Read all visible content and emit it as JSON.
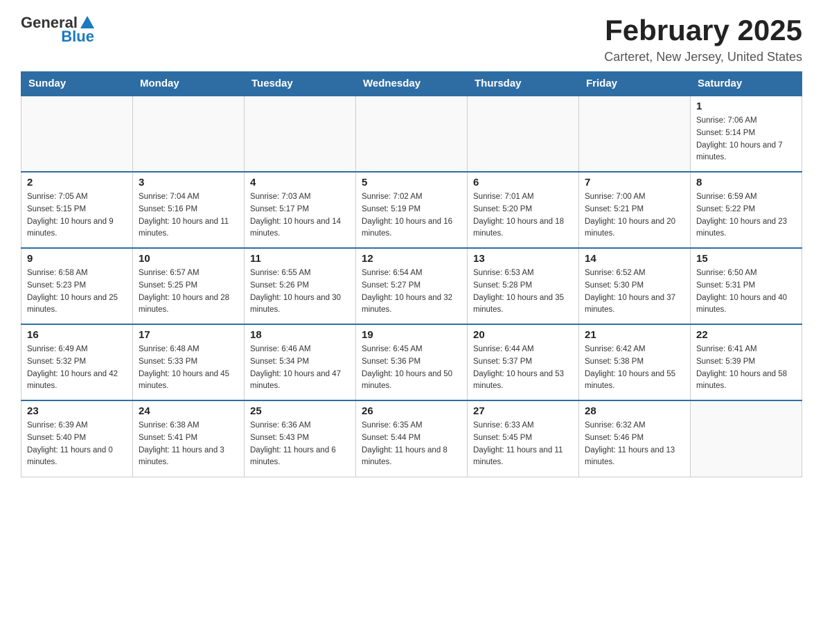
{
  "header": {
    "logo_general": "General",
    "logo_blue": "Blue",
    "title": "February 2025",
    "subtitle": "Carteret, New Jersey, United States"
  },
  "days_of_week": [
    "Sunday",
    "Monday",
    "Tuesday",
    "Wednesday",
    "Thursday",
    "Friday",
    "Saturday"
  ],
  "weeks": [
    [
      {
        "day": "",
        "info": ""
      },
      {
        "day": "",
        "info": ""
      },
      {
        "day": "",
        "info": ""
      },
      {
        "day": "",
        "info": ""
      },
      {
        "day": "",
        "info": ""
      },
      {
        "day": "",
        "info": ""
      },
      {
        "day": "1",
        "info": "Sunrise: 7:06 AM\nSunset: 5:14 PM\nDaylight: 10 hours and 7 minutes."
      }
    ],
    [
      {
        "day": "2",
        "info": "Sunrise: 7:05 AM\nSunset: 5:15 PM\nDaylight: 10 hours and 9 minutes."
      },
      {
        "day": "3",
        "info": "Sunrise: 7:04 AM\nSunset: 5:16 PM\nDaylight: 10 hours and 11 minutes."
      },
      {
        "day": "4",
        "info": "Sunrise: 7:03 AM\nSunset: 5:17 PM\nDaylight: 10 hours and 14 minutes."
      },
      {
        "day": "5",
        "info": "Sunrise: 7:02 AM\nSunset: 5:19 PM\nDaylight: 10 hours and 16 minutes."
      },
      {
        "day": "6",
        "info": "Sunrise: 7:01 AM\nSunset: 5:20 PM\nDaylight: 10 hours and 18 minutes."
      },
      {
        "day": "7",
        "info": "Sunrise: 7:00 AM\nSunset: 5:21 PM\nDaylight: 10 hours and 20 minutes."
      },
      {
        "day": "8",
        "info": "Sunrise: 6:59 AM\nSunset: 5:22 PM\nDaylight: 10 hours and 23 minutes."
      }
    ],
    [
      {
        "day": "9",
        "info": "Sunrise: 6:58 AM\nSunset: 5:23 PM\nDaylight: 10 hours and 25 minutes."
      },
      {
        "day": "10",
        "info": "Sunrise: 6:57 AM\nSunset: 5:25 PM\nDaylight: 10 hours and 28 minutes."
      },
      {
        "day": "11",
        "info": "Sunrise: 6:55 AM\nSunset: 5:26 PM\nDaylight: 10 hours and 30 minutes."
      },
      {
        "day": "12",
        "info": "Sunrise: 6:54 AM\nSunset: 5:27 PM\nDaylight: 10 hours and 32 minutes."
      },
      {
        "day": "13",
        "info": "Sunrise: 6:53 AM\nSunset: 5:28 PM\nDaylight: 10 hours and 35 minutes."
      },
      {
        "day": "14",
        "info": "Sunrise: 6:52 AM\nSunset: 5:30 PM\nDaylight: 10 hours and 37 minutes."
      },
      {
        "day": "15",
        "info": "Sunrise: 6:50 AM\nSunset: 5:31 PM\nDaylight: 10 hours and 40 minutes."
      }
    ],
    [
      {
        "day": "16",
        "info": "Sunrise: 6:49 AM\nSunset: 5:32 PM\nDaylight: 10 hours and 42 minutes."
      },
      {
        "day": "17",
        "info": "Sunrise: 6:48 AM\nSunset: 5:33 PM\nDaylight: 10 hours and 45 minutes."
      },
      {
        "day": "18",
        "info": "Sunrise: 6:46 AM\nSunset: 5:34 PM\nDaylight: 10 hours and 47 minutes."
      },
      {
        "day": "19",
        "info": "Sunrise: 6:45 AM\nSunset: 5:36 PM\nDaylight: 10 hours and 50 minutes."
      },
      {
        "day": "20",
        "info": "Sunrise: 6:44 AM\nSunset: 5:37 PM\nDaylight: 10 hours and 53 minutes."
      },
      {
        "day": "21",
        "info": "Sunrise: 6:42 AM\nSunset: 5:38 PM\nDaylight: 10 hours and 55 minutes."
      },
      {
        "day": "22",
        "info": "Sunrise: 6:41 AM\nSunset: 5:39 PM\nDaylight: 10 hours and 58 minutes."
      }
    ],
    [
      {
        "day": "23",
        "info": "Sunrise: 6:39 AM\nSunset: 5:40 PM\nDaylight: 11 hours and 0 minutes."
      },
      {
        "day": "24",
        "info": "Sunrise: 6:38 AM\nSunset: 5:41 PM\nDaylight: 11 hours and 3 minutes."
      },
      {
        "day": "25",
        "info": "Sunrise: 6:36 AM\nSunset: 5:43 PM\nDaylight: 11 hours and 6 minutes."
      },
      {
        "day": "26",
        "info": "Sunrise: 6:35 AM\nSunset: 5:44 PM\nDaylight: 11 hours and 8 minutes."
      },
      {
        "day": "27",
        "info": "Sunrise: 6:33 AM\nSunset: 5:45 PM\nDaylight: 11 hours and 11 minutes."
      },
      {
        "day": "28",
        "info": "Sunrise: 6:32 AM\nSunset: 5:46 PM\nDaylight: 11 hours and 13 minutes."
      },
      {
        "day": "",
        "info": ""
      }
    ]
  ]
}
